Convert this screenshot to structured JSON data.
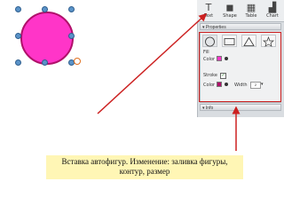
{
  "toolbar": {
    "tools": [
      {
        "icon": "text-icon",
        "label": "Text"
      },
      {
        "icon": "shape-icon",
        "label": "Shape"
      },
      {
        "icon": "table-icon",
        "label": "Table"
      },
      {
        "icon": "chart-icon",
        "label": "Chart"
      }
    ]
  },
  "properties": {
    "header": "Properties",
    "fill_label": "Fill",
    "fill_color_label": "Color",
    "stroke_label": "Stroke",
    "stroke_color_label": "Color",
    "width_label": "Width",
    "width_value": "2"
  },
  "info": {
    "header": "Info"
  },
  "caption": {
    "line1": "Вставка автофигур. Изменение: заливка фигуры,",
    "line2": "контур, размер"
  },
  "colors": {
    "shape_fill": "#ff35c8",
    "shape_stroke": "#b0106a",
    "stroke_swatch": "#b0106a",
    "annotation_red": "#cc2020",
    "caption_bg": "#fff6b5"
  }
}
